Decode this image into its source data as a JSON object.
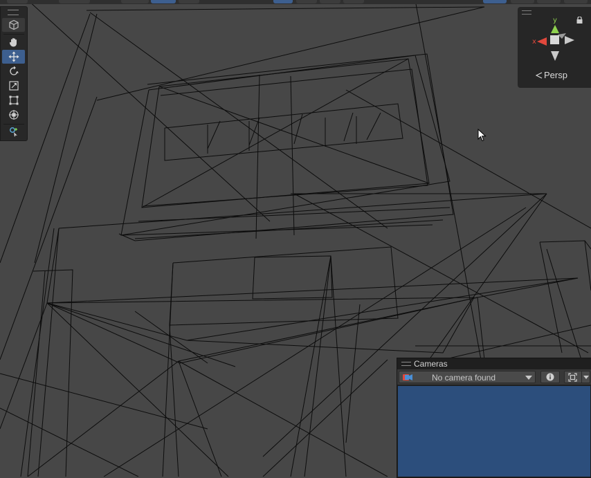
{
  "scene_view": {
    "background": "#474747",
    "wire_color": "#0c0c0c"
  },
  "tools": {
    "items": [
      {
        "name": "view-tool",
        "icon": "cube-view-icon"
      },
      {
        "name": "hand-tool",
        "icon": "hand-icon"
      },
      {
        "name": "move-tool",
        "icon": "move-arrows-icon",
        "active": true
      },
      {
        "name": "rotate-tool",
        "icon": "rotate-icon"
      },
      {
        "name": "scale-tool",
        "icon": "scale-icon"
      },
      {
        "name": "rect-tool",
        "icon": "rect-transform-icon"
      },
      {
        "name": "transform-tool",
        "icon": "transform-icon"
      },
      {
        "name": "custom-tool",
        "icon": "custom-editor-tool-icon"
      }
    ],
    "accent": "#3d5f8f"
  },
  "gizmo": {
    "y_label": "y",
    "x_label": "x",
    "projection_label": "Persp",
    "colors": {
      "y": "#8fd14f",
      "x": "#e0483c",
      "neutral": "#d0d0d0"
    }
  },
  "cameras_overlay": {
    "title": "Cameras",
    "camera_dropdown": {
      "selected": "No camera found"
    },
    "info_icon": "info-icon",
    "fit_icon": "frame-fit-icon",
    "preview_color": "#2c4e7c"
  }
}
